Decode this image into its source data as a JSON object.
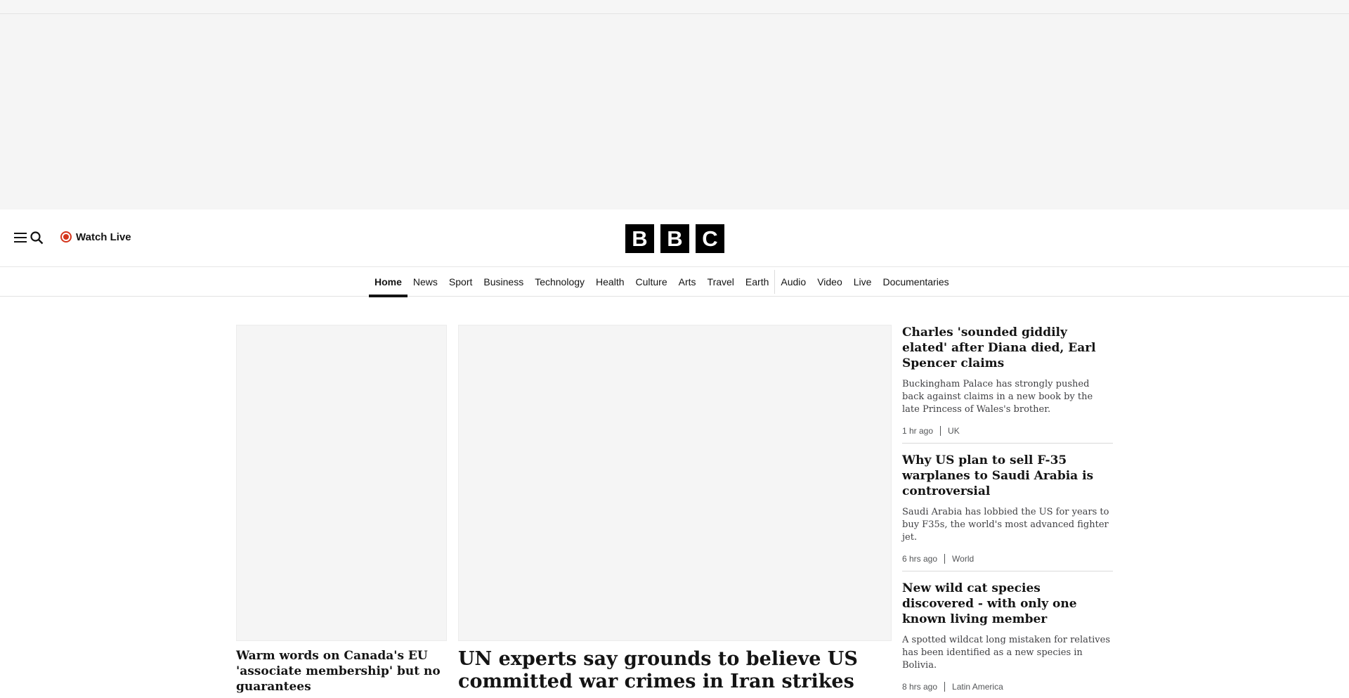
{
  "header": {
    "watch_live_label": "Watch Live",
    "logo_letters": [
      "B",
      "B",
      "C"
    ]
  },
  "nav": {
    "items": [
      {
        "label": "Home",
        "active": true
      },
      {
        "label": "News"
      },
      {
        "label": "Sport"
      },
      {
        "label": "Business"
      },
      {
        "label": "Technology"
      },
      {
        "label": "Health"
      },
      {
        "label": "Culture"
      },
      {
        "label": "Arts"
      },
      {
        "label": "Travel"
      },
      {
        "label": "Earth"
      },
      {
        "label": "Audio"
      },
      {
        "label": "Video"
      },
      {
        "label": "Live"
      },
      {
        "label": "Documentaries"
      }
    ]
  },
  "left_story": {
    "title": "Warm words on Canada's EU 'associate membership' but no guarantees"
  },
  "main_story": {
    "title": "UN experts say grounds to believe US committed war crimes in Iran strikes"
  },
  "right_stories": [
    {
      "title": "Charles 'sounded giddily elated' after Diana died, Earl Spencer claims",
      "summary": "Buckingham Palace has strongly pushed back against claims in a new book by the late Princess of Wales's brother.",
      "time": "1 hr ago",
      "category": "UK"
    },
    {
      "title": "Why US plan to sell F-35 warplanes to Saudi Arabia is controversial",
      "summary": "Saudi Arabia has lobbied the US for years to buy F35s, the world's most advanced fighter jet.",
      "time": "6 hrs ago",
      "category": "World"
    },
    {
      "title": "New wild cat species discovered - with only one known living member",
      "summary": "A spotted wildcat long mistaken for relatives has been identified as a new species in Bolivia.",
      "time": "8 hrs ago",
      "category": "Latin America"
    }
  ],
  "colors": {
    "live_red": "#d4351c",
    "logo_black": "#000000",
    "placeholder_grey": "#f5f5f5"
  }
}
